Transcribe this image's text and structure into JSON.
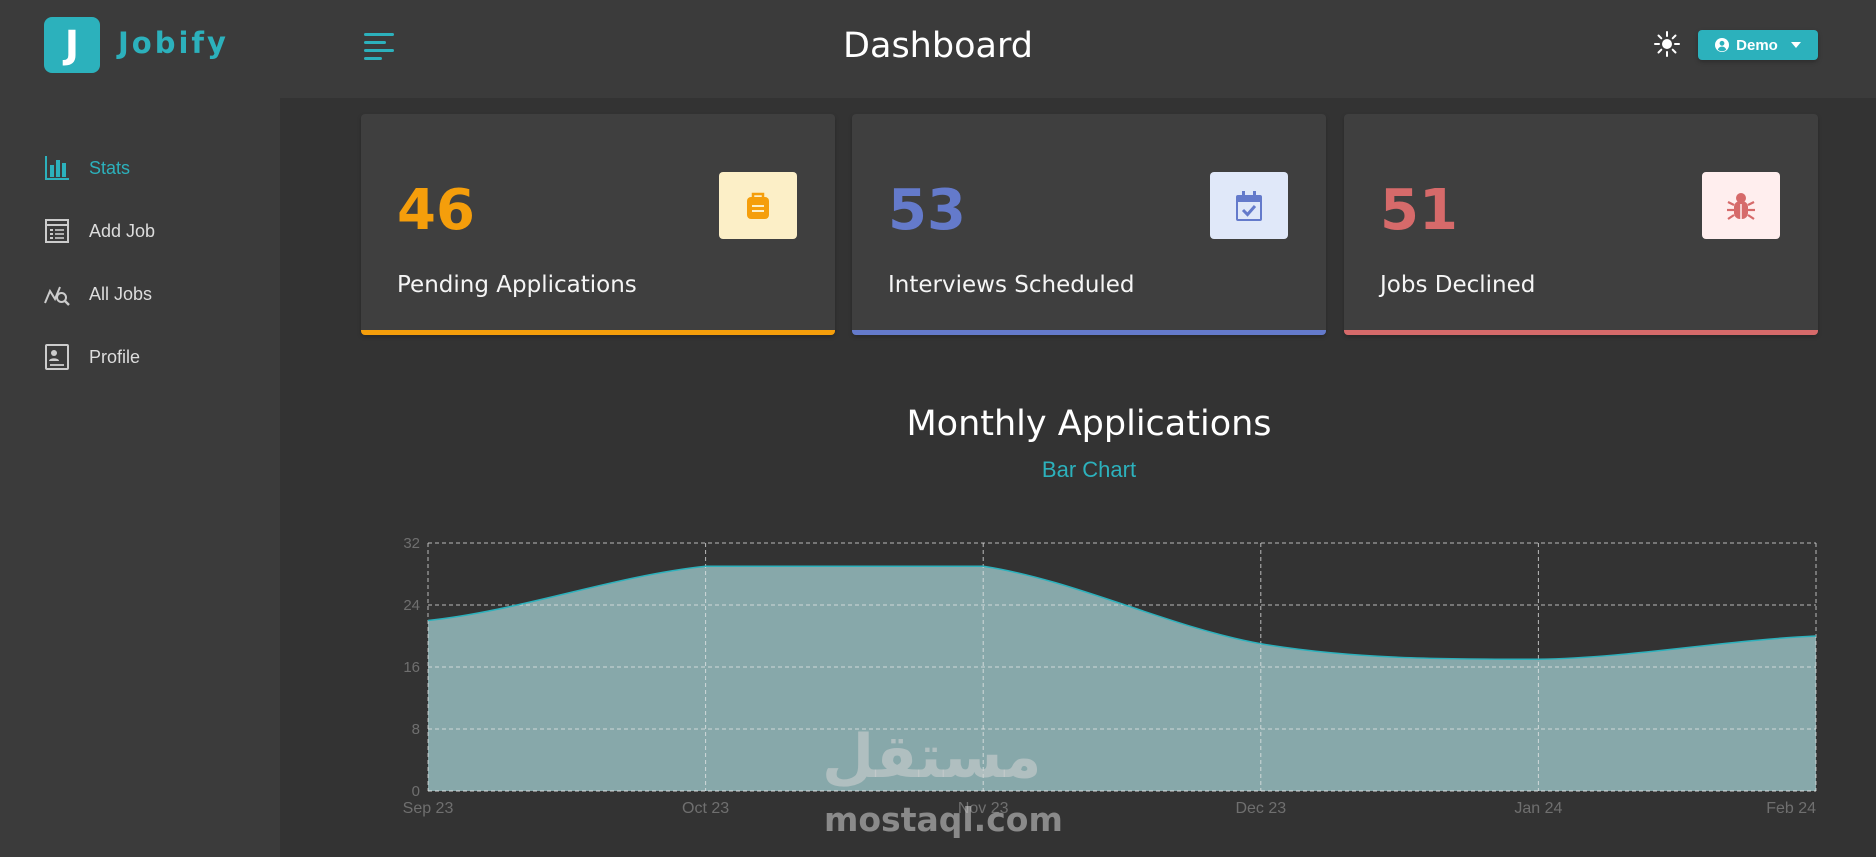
{
  "app": {
    "logo_letter": "J",
    "brand": "Jobify",
    "page_title": "Dashboard"
  },
  "header": {
    "user_label": "Demo"
  },
  "sidebar": {
    "items": [
      {
        "label": "Stats",
        "icon": "stats-icon",
        "active": true
      },
      {
        "label": "Add Job",
        "icon": "add-job-icon"
      },
      {
        "label": "All Jobs",
        "icon": "all-jobs-icon"
      },
      {
        "label": "Profile",
        "icon": "profile-icon"
      }
    ]
  },
  "stats": [
    {
      "count": "46",
      "label": "Pending Applications",
      "color": "#f59e0b",
      "icon": "briefcase-icon",
      "icon_bg": "#fcefc7"
    },
    {
      "count": "53",
      "label": "Interviews Scheduled",
      "color": "#647acb",
      "icon": "calendar-check-icon",
      "icon_bg": "#e0e8f9"
    },
    {
      "count": "51",
      "label": "Jobs Declined",
      "color": "#d66a6a",
      "icon": "bug-icon",
      "icon_bg": "#ffeeee"
    }
  ],
  "chart": {
    "title": "Monthly Applications",
    "toggle_label": "Bar Chart"
  },
  "chart_data": {
    "type": "area",
    "categories": [
      "Sep 23",
      "Oct 23",
      "Nov 23",
      "Dec 23",
      "Jan 24",
      "Feb 24"
    ],
    "values": [
      22,
      29,
      29,
      19,
      17,
      20
    ],
    "ylim": [
      0,
      32
    ],
    "yticks": [
      0,
      8,
      16,
      24,
      32
    ],
    "grid": true,
    "fill_color": "#87a8aa",
    "line_color": "#2cb1bc"
  },
  "watermark": {
    "arabic": "مستقل",
    "latin": "mostaql.com"
  }
}
